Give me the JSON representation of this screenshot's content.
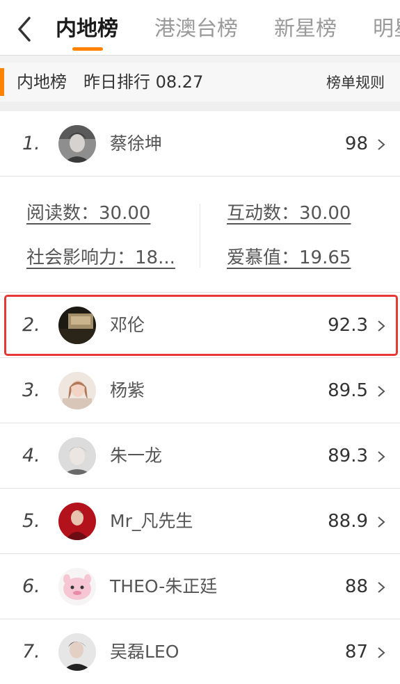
{
  "tabs": [
    {
      "label": "内地榜",
      "active": true
    },
    {
      "label": "港澳台榜",
      "active": false
    },
    {
      "label": "新星榜",
      "active": false
    },
    {
      "label": "明星",
      "active": false
    }
  ],
  "info": {
    "title": "内地榜",
    "date": "昨日排行 08.27",
    "rules": "榜单规则"
  },
  "stats": {
    "reads": "阅读数：30.00",
    "interaction": "互动数：30.00",
    "influence": "社会影响力：18...",
    "love": "爱慕值：19.65"
  },
  "rankings": [
    {
      "rank": "1.",
      "name": "蔡徐坤",
      "score": "98"
    },
    {
      "rank": "2.",
      "name": "邓伦",
      "score": "92.3"
    },
    {
      "rank": "3.",
      "name": "杨紫",
      "score": "89.5"
    },
    {
      "rank": "4.",
      "name": "朱一龙",
      "score": "89.3"
    },
    {
      "rank": "5.",
      "name": "Mr_凡先生",
      "score": "88.9"
    },
    {
      "rank": "6.",
      "name": "THEO-朱正廷",
      "score": "88"
    },
    {
      "rank": "7.",
      "name": "吴磊LEO",
      "score": "87"
    }
  ],
  "colors": {
    "accent": "#ff8200",
    "highlight": "#e53935"
  }
}
